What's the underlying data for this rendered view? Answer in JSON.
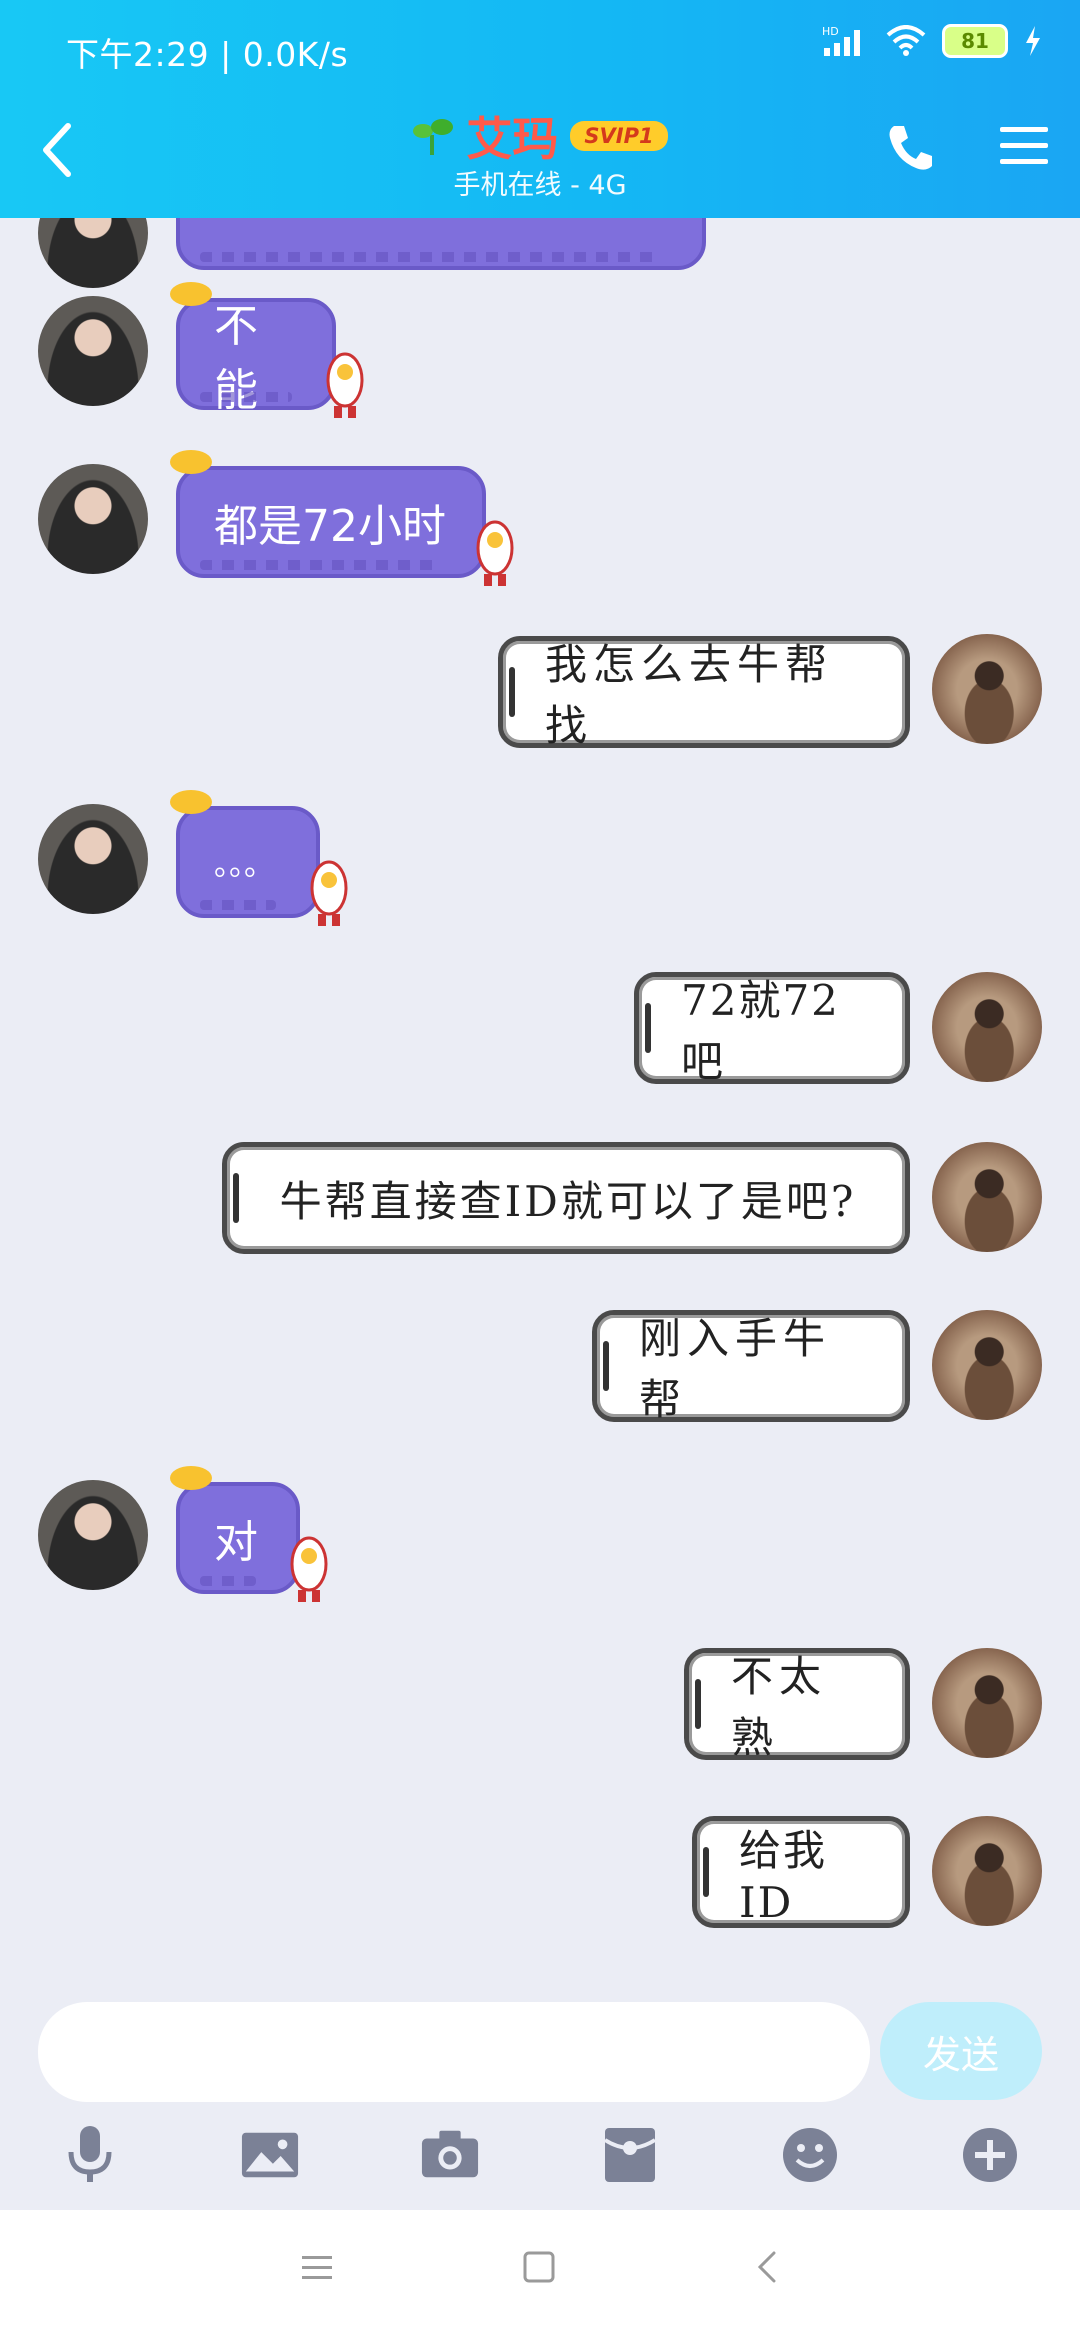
{
  "status_bar": {
    "time_speed": "下午2:29 | 0.0K/s",
    "battery": "81"
  },
  "header": {
    "contact_name": "艾玛",
    "vip_badge": "SVIP1",
    "status": "手机在线 - 4G"
  },
  "messages": [
    {
      "side": "left",
      "text": "不能"
    },
    {
      "side": "left",
      "text": "都是72小时"
    },
    {
      "side": "right",
      "text": "我怎么去牛帮找"
    },
    {
      "side": "left",
      "text": "。。。"
    },
    {
      "side": "right",
      "text": "72就72吧"
    },
    {
      "side": "right",
      "text": "牛帮直接查ID就可以了是吧?"
    },
    {
      "side": "right",
      "text": "刚入手牛帮"
    },
    {
      "side": "left",
      "text": "对"
    },
    {
      "side": "right",
      "text": "不太熟"
    },
    {
      "side": "right",
      "text": "给我ID"
    }
  ],
  "input": {
    "placeholder": "",
    "send_label": "发送"
  },
  "toolbar": [
    "mic-icon",
    "image-icon",
    "camera-icon",
    "red-packet-icon",
    "emoji-icon",
    "plus-icon"
  ],
  "colors": {
    "header": "#14b8f4",
    "bubble_purple": "#7f6fdc",
    "send_disabled": "#bfeefb"
  }
}
